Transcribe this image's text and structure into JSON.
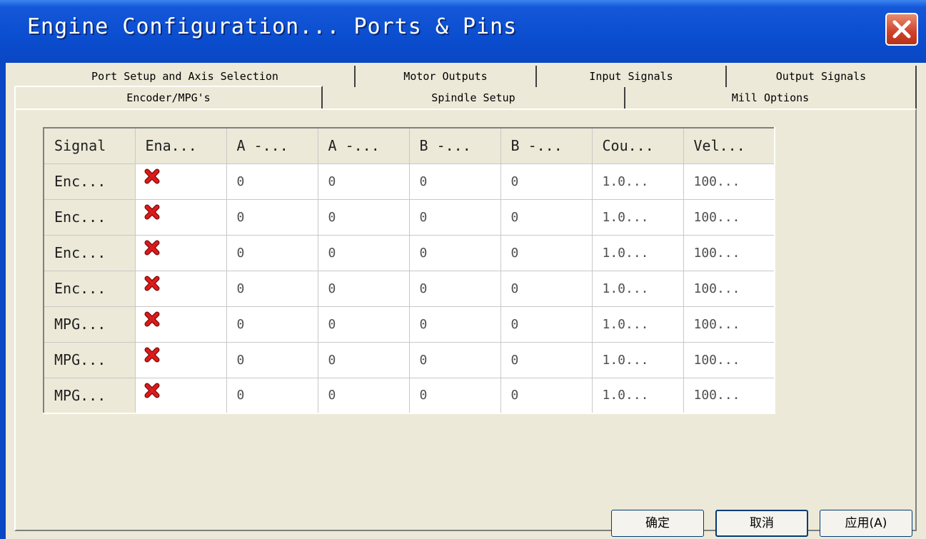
{
  "window": {
    "title": "Engine Configuration... Ports & Pins"
  },
  "tabs": {
    "row1": [
      {
        "label": "Port Setup and Axis Selection"
      },
      {
        "label": "Motor Outputs"
      },
      {
        "label": "Input Signals"
      },
      {
        "label": "Output Signals"
      }
    ],
    "row2": [
      {
        "label": "Encoder/MPG's",
        "selected": true
      },
      {
        "label": "Spindle Setup"
      },
      {
        "label": "Mill Options"
      }
    ]
  },
  "grid": {
    "columns": [
      "Signal",
      "Ena...",
      "A -...",
      "A -...",
      "B -...",
      "B -...",
      "Cou...",
      "Vel..."
    ],
    "rows": [
      {
        "signal": "Enc...",
        "enabled": false,
        "a_port": "0",
        "a_pin": "0",
        "b_port": "0",
        "b_pin": "0",
        "counts": "1.0...",
        "velocity": "100..."
      },
      {
        "signal": "Enc...",
        "enabled": false,
        "a_port": "0",
        "a_pin": "0",
        "b_port": "0",
        "b_pin": "0",
        "counts": "1.0...",
        "velocity": "100..."
      },
      {
        "signal": "Enc...",
        "enabled": false,
        "a_port": "0",
        "a_pin": "0",
        "b_port": "0",
        "b_pin": "0",
        "counts": "1.0...",
        "velocity": "100..."
      },
      {
        "signal": "Enc...",
        "enabled": false,
        "a_port": "0",
        "a_pin": "0",
        "b_port": "0",
        "b_pin": "0",
        "counts": "1.0...",
        "velocity": "100..."
      },
      {
        "signal": "MPG...",
        "enabled": false,
        "a_port": "0",
        "a_pin": "0",
        "b_port": "0",
        "b_pin": "0",
        "counts": "1.0...",
        "velocity": "100..."
      },
      {
        "signal": "MPG...",
        "enabled": false,
        "a_port": "0",
        "a_pin": "0",
        "b_port": "0",
        "b_pin": "0",
        "counts": "1.0...",
        "velocity": "100..."
      },
      {
        "signal": "MPG...",
        "enabled": false,
        "a_port": "0",
        "a_pin": "0",
        "b_port": "0",
        "b_pin": "0",
        "counts": "1.0...",
        "velocity": "100..."
      }
    ],
    "enabled_icon": "red-x-icon"
  },
  "buttons": {
    "ok": "确定",
    "cancel": "取消",
    "apply": "应用(A)"
  },
  "colors": {
    "title_bar": "#0a4ed0",
    "close_button": "#d0402a",
    "dialog_bg": "#ece9d8",
    "disabled_mark": "#cc1111"
  }
}
